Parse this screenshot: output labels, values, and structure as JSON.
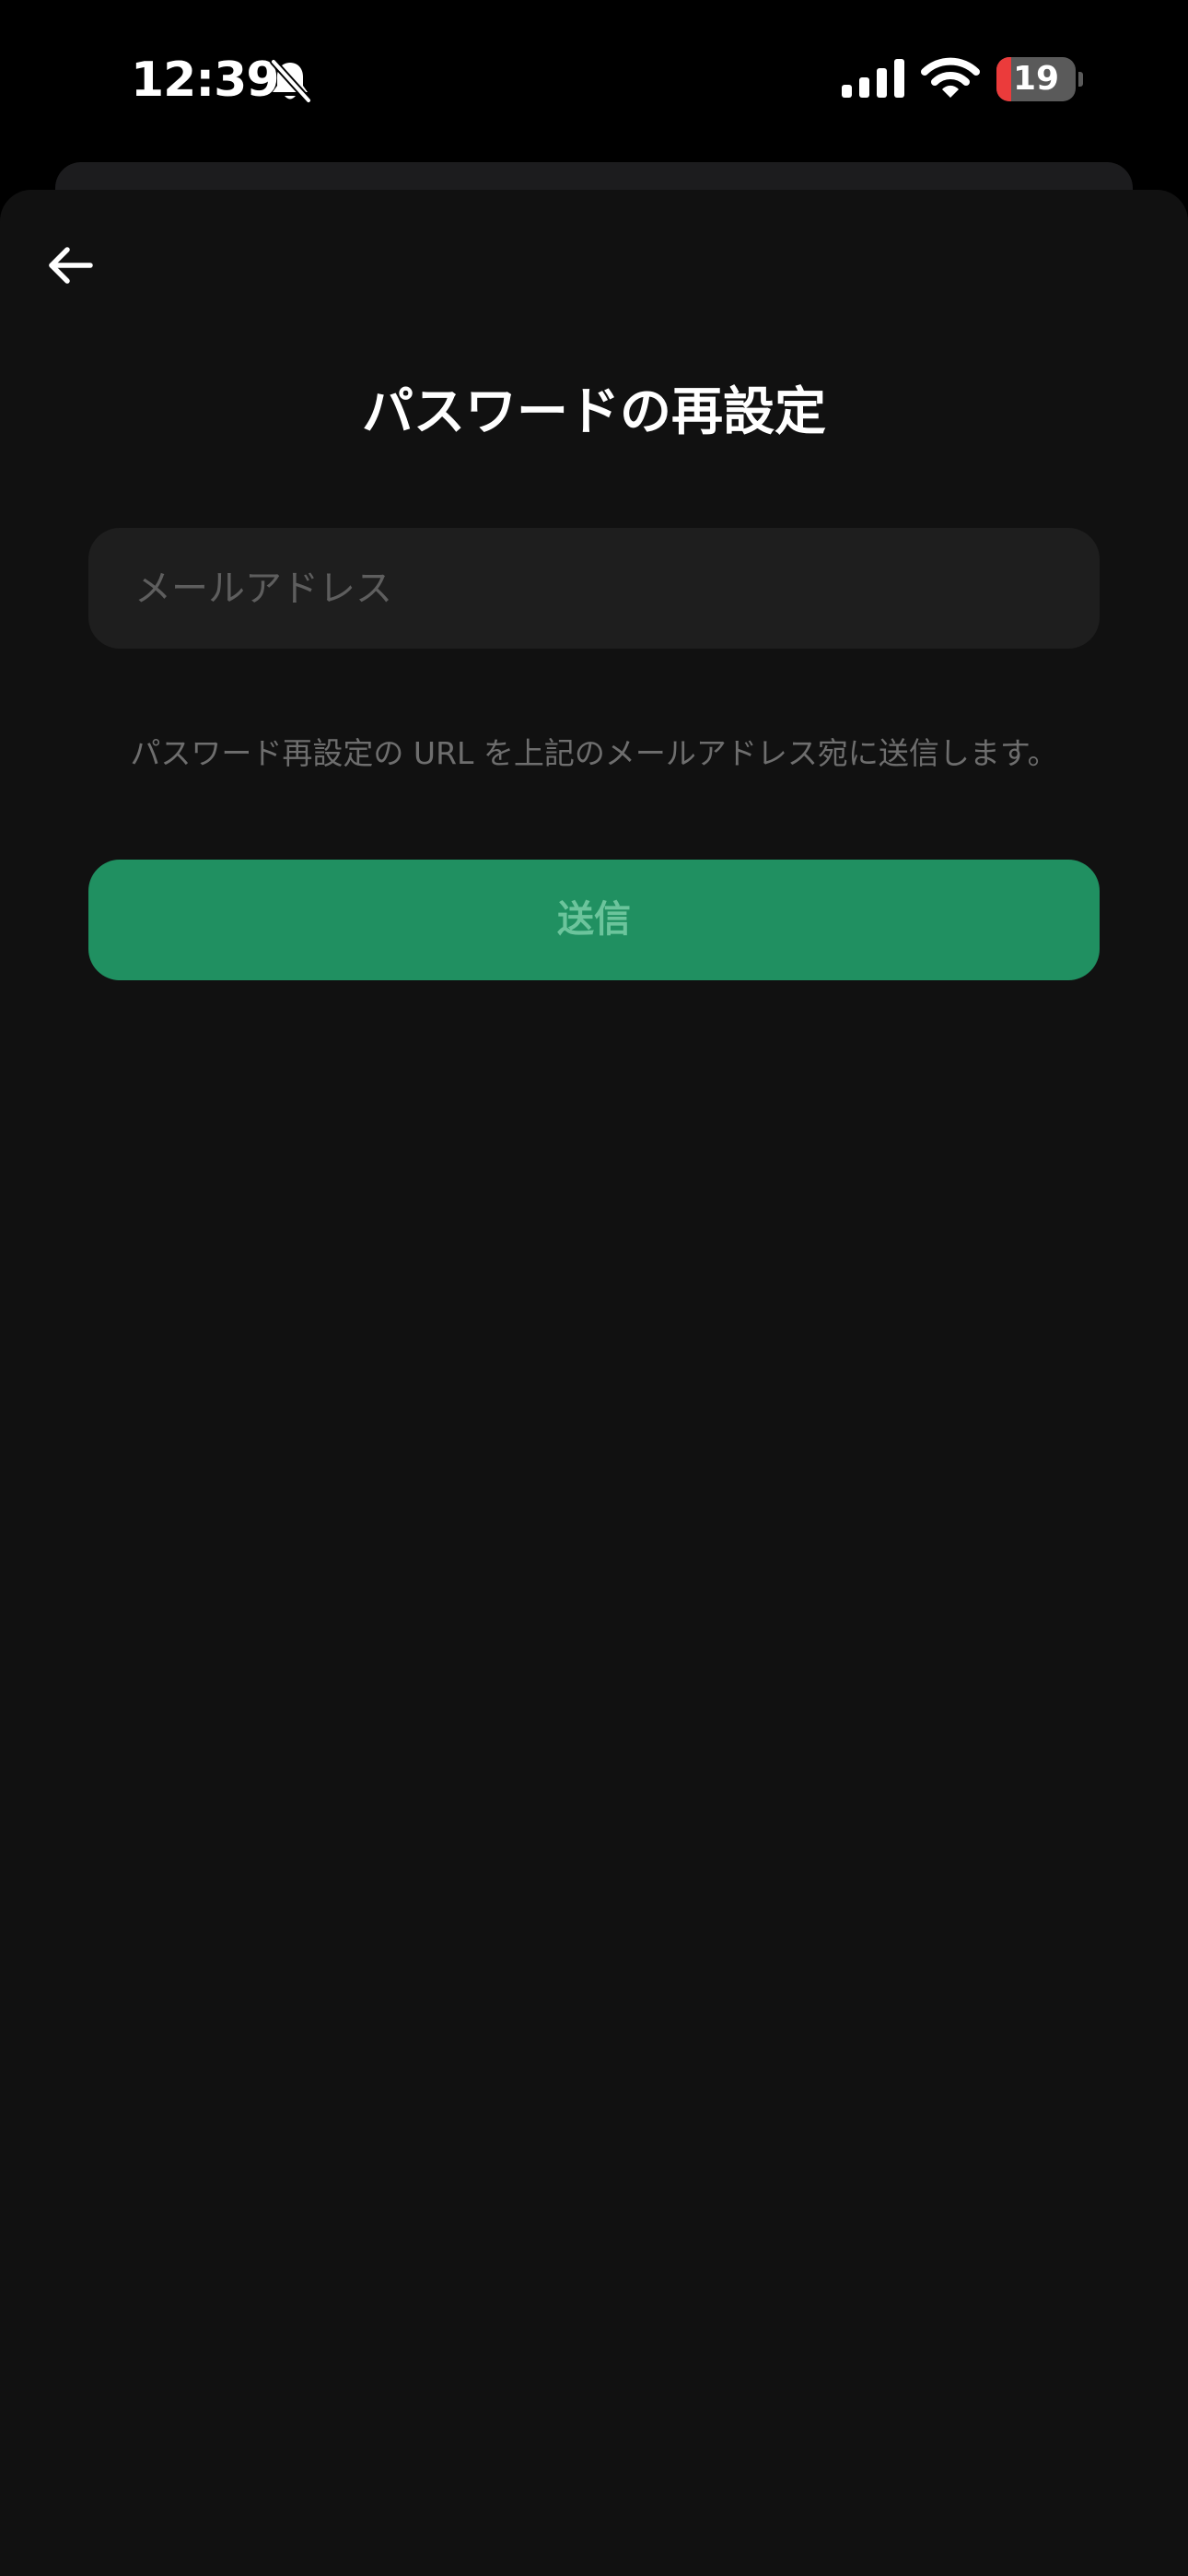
{
  "status_bar": {
    "time": "12:39",
    "bell_icon": "bell-slash-icon",
    "signal_icon": "cellular-signal-icon",
    "wifi_icon": "wifi-icon",
    "battery_level": "19",
    "battery_fraction": 0.19,
    "battery_color": "#eb3b3b"
  },
  "nav": {
    "back_icon": "arrow-left-icon"
  },
  "page": {
    "title": "パスワードの再設定"
  },
  "email_input": {
    "placeholder": "メールアドレス",
    "value": ""
  },
  "helper": {
    "text": "パスワード再設定の URL を上記のメールアドレス宛に送信します。"
  },
  "submit": {
    "label": "送信",
    "background": "#209061",
    "text_color": "#6cc49c"
  }
}
